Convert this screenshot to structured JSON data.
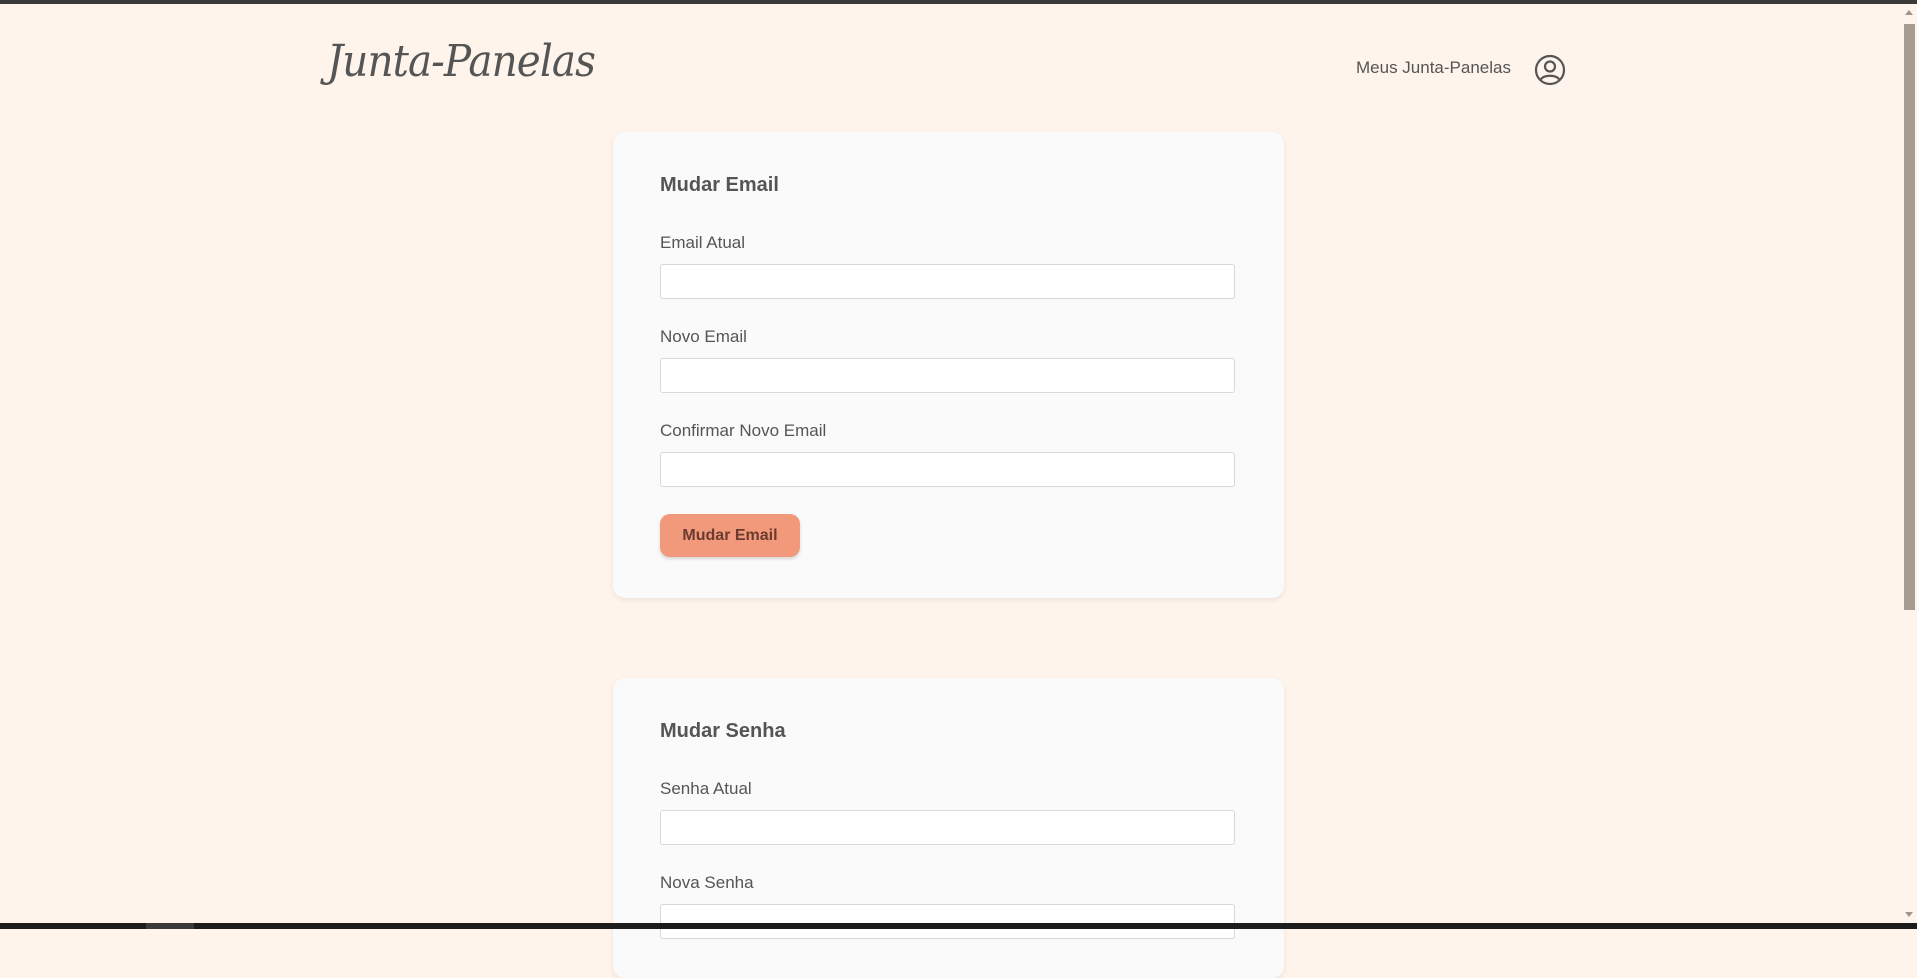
{
  "header": {
    "logo_text": "Junta-Panelas",
    "nav_link": "Meus Junta-Panelas",
    "user_icon": "user-circle-icon"
  },
  "email_card": {
    "title": "Mudar Email",
    "fields": [
      {
        "label": "Email Atual",
        "value": "",
        "placeholder": ""
      },
      {
        "label": "Novo Email",
        "value": "",
        "placeholder": ""
      },
      {
        "label": "Confirmar Novo Email",
        "value": "",
        "placeholder": ""
      }
    ],
    "button_label": "Mudar Email"
  },
  "password_card": {
    "title": "Mudar Senha",
    "fields": [
      {
        "label": "Senha Atual",
        "value": "",
        "placeholder": ""
      },
      {
        "label": "Nova Senha",
        "value": "",
        "placeholder": ""
      }
    ]
  },
  "colors": {
    "background": "#fff4eb",
    "card": "#fafafa",
    "accent_button": "#f2997c",
    "text": "#555555"
  }
}
